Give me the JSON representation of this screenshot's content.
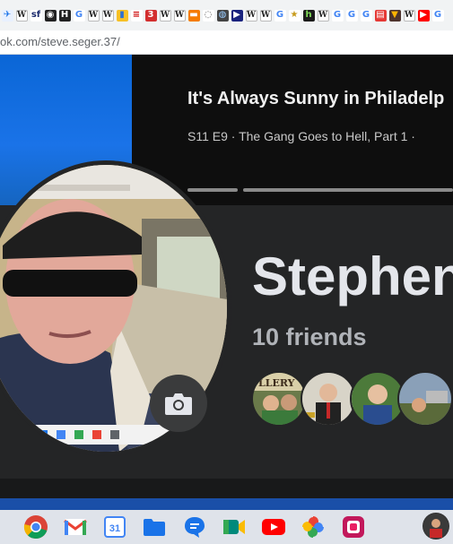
{
  "browser": {
    "bookmark_icons": [
      {
        "name": "plane-icon",
        "glyph": "✈",
        "bg": "#e8f0fe",
        "fg": "#1a73e8"
      },
      {
        "name": "wikipedia-icon",
        "glyph": "W",
        "style": "w"
      },
      {
        "name": "sf-icon",
        "glyph": "sf",
        "bg": "#fff",
        "fg": "#1a2a6c"
      },
      {
        "name": "globe-icon",
        "glyph": "◉",
        "bg": "#222",
        "fg": "#fff"
      },
      {
        "name": "h-icon",
        "glyph": "H",
        "bg": "#222",
        "fg": "#fff"
      },
      {
        "name": "google-icon",
        "glyph": "G",
        "bg": "#fff",
        "fg": "#4285f4"
      },
      {
        "name": "wikipedia-icon",
        "glyph": "W",
        "style": "w"
      },
      {
        "name": "wikipedia-icon",
        "glyph": "W",
        "style": "w"
      },
      {
        "name": "bag-icon",
        "glyph": "▮",
        "bg": "#f6c026",
        "fg": "#2c6fd1"
      },
      {
        "name": "news-icon",
        "glyph": "≡",
        "bg": "#fff",
        "fg": "#c00"
      },
      {
        "name": "channel-3-icon",
        "glyph": "3",
        "bg": "#d32f2f",
        "fg": "#fff"
      },
      {
        "name": "wikipedia-icon",
        "glyph": "W",
        "style": "w"
      },
      {
        "name": "wikipedia-icon",
        "glyph": "W",
        "style": "w"
      },
      {
        "name": "stack-icon",
        "glyph": "▬",
        "bg": "#f57c00",
        "fg": "#fff"
      },
      {
        "name": "circle-icon",
        "glyph": "◌",
        "bg": "#fff",
        "fg": "#555"
      },
      {
        "name": "earth-icon",
        "glyph": "◍",
        "bg": "#444",
        "fg": "#9cf"
      },
      {
        "name": "flag-icon",
        "glyph": "▶",
        "bg": "#1a237e",
        "fg": "#fff"
      },
      {
        "name": "wikipedia-icon",
        "glyph": "W",
        "style": "w"
      },
      {
        "name": "wikipedia-icon",
        "glyph": "W",
        "style": "w"
      },
      {
        "name": "google-icon",
        "glyph": "G",
        "bg": "#fff",
        "fg": "#4285f4"
      },
      {
        "name": "star-icon",
        "glyph": "★",
        "bg": "#fff",
        "fg": "#c79b1c"
      },
      {
        "name": "h-green-icon",
        "glyph": "h",
        "bg": "#1b1b1b",
        "fg": "#7ed957"
      },
      {
        "name": "wikipedia-icon",
        "glyph": "W",
        "style": "w"
      },
      {
        "name": "google-icon",
        "glyph": "G",
        "bg": "#fff",
        "fg": "#4285f4"
      },
      {
        "name": "google-icon",
        "glyph": "G",
        "bg": "#fff",
        "fg": "#4285f4"
      },
      {
        "name": "google-icon",
        "glyph": "G",
        "bg": "#fff",
        "fg": "#4285f4"
      },
      {
        "name": "red-square-icon",
        "glyph": "▤",
        "bg": "#e53935",
        "fg": "#fff"
      },
      {
        "name": "ups-icon",
        "glyph": "▼",
        "bg": "#4e342e",
        "fg": "#ffb300"
      },
      {
        "name": "wikipedia-icon",
        "glyph": "W",
        "style": "w"
      },
      {
        "name": "youtube-icon",
        "glyph": "▶",
        "bg": "#ff0000",
        "fg": "#fff"
      },
      {
        "name": "google-icon",
        "glyph": "G",
        "bg": "#fff",
        "fg": "#4285f4"
      }
    ],
    "url_host": "ok.com",
    "url_path": "/steve.seger.37/"
  },
  "cover": {
    "show_title": "It's Always Sunny in Philadelp",
    "show_episode": "S11 E9  ·  The Gang Goes to Hell, Part 1  ·"
  },
  "profile": {
    "name": "Stephen",
    "friends_count": "10 friends",
    "accent": "#242526"
  },
  "shelf": {
    "apps": [
      {
        "name": "chrome-icon"
      },
      {
        "name": "gmail-icon"
      },
      {
        "name": "calendar-icon",
        "label": "31"
      },
      {
        "name": "files-icon"
      },
      {
        "name": "messages-icon"
      },
      {
        "name": "meet-icon"
      },
      {
        "name": "youtube-icon"
      },
      {
        "name": "photos-icon"
      },
      {
        "name": "app-icon"
      }
    ]
  }
}
